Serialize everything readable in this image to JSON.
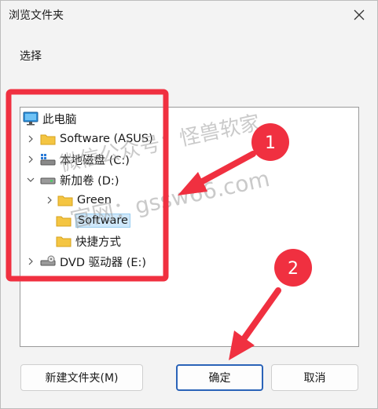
{
  "window": {
    "title": "浏览文件夹"
  },
  "prompt": "选择",
  "tree": {
    "this_pc": "此电脑",
    "software_asus": "Software (ASUS)",
    "local_c": "本地磁盘 (C:)",
    "new_volume_d": "新加卷 (D:)",
    "green": "Green",
    "software": "Software",
    "shortcuts": "快捷方式",
    "dvd_e": "DVD 驱动器 (E:)"
  },
  "buttons": {
    "new_folder": "新建文件夹(M)",
    "ok": "确定",
    "cancel": "取消"
  },
  "annotations": {
    "badge_1": "1",
    "badge_2": "2"
  },
  "watermark": {
    "line1": "微信公众号：怪兽软家",
    "line2": "官网：gssw66.com"
  },
  "colors": {
    "highlight_box": "#f03040",
    "selected_bg": "#cfe8fb",
    "folder": "#f4c542",
    "primary_border": "#2a63b8"
  },
  "icons": {
    "this_pc": "monitor-icon",
    "folder": "folder-icon",
    "drive": "drive-icon",
    "dvd": "dvd-drive-icon"
  }
}
